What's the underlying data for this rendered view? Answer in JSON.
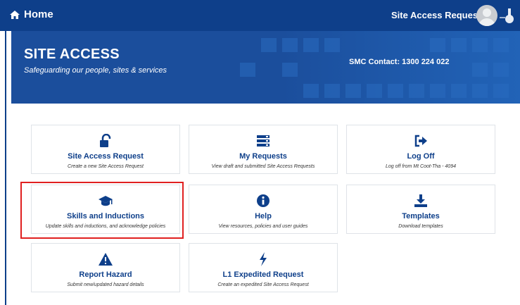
{
  "header": {
    "home_label": "Home",
    "site_access_requests_label": "Site Access Requests"
  },
  "banner": {
    "title": "SITE ACCESS",
    "subtitle": "Safeguarding our people, sites & services",
    "contact": "SMC Contact: 1300 224 022"
  },
  "tiles": [
    {
      "title": "Site Access Request",
      "desc": "Create a new Site Access Request",
      "icon": "unlock-icon"
    },
    {
      "title": "My Requests",
      "desc": "View draft and submitted Site Access Requests",
      "icon": "list-icon"
    },
    {
      "title": "Log Off",
      "desc": "Log off from Mt Coot-Tha - 4094",
      "icon": "sign-out-icon"
    },
    {
      "title": "Skills and Inductions",
      "desc": "Update skills and inductions, and acknowledge policies",
      "icon": "graduation-cap-icon"
    },
    {
      "title": "Help",
      "desc": "View resources, policies and user guides",
      "icon": "info-icon"
    },
    {
      "title": "Templates",
      "desc": "Download templates",
      "icon": "download-icon"
    },
    {
      "title": "Report Hazard",
      "desc": "Submit new/updated hazard details",
      "icon": "warning-icon"
    },
    {
      "title": "L1 Expedited Request",
      "desc": "Create an expedited Site Access Request",
      "icon": "bolt-icon"
    }
  ],
  "colors": {
    "brand": "#0e3f8a",
    "highlight": "#e02020"
  }
}
